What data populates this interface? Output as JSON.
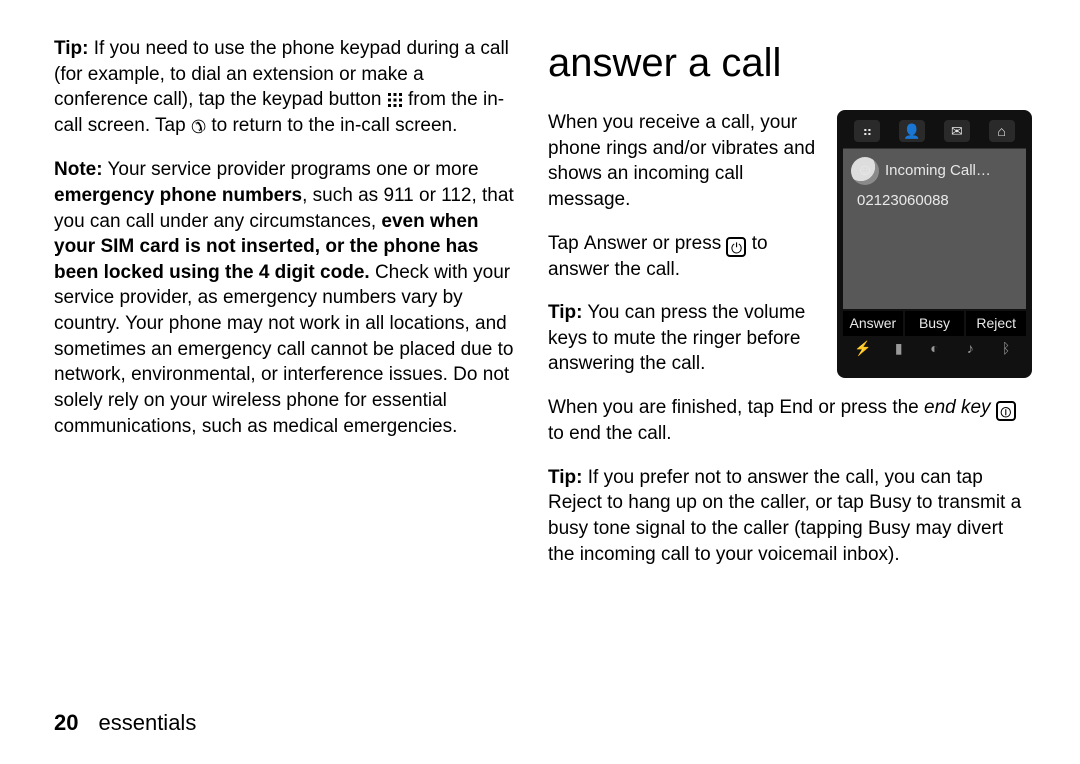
{
  "left": {
    "tip_label": "Tip:",
    "tip_text_a": " If you need to use the phone keypad during a call (for example, to dial an extension or make a conference call), tap the keypad button ",
    "tip_text_b": " from the in-call screen. Tap ",
    "tip_text_c": " to return to the in-call screen.",
    "note_label": "Note:",
    "note_a": " Your service provider programs one or more ",
    "note_b_bold": "emergency phone numbers",
    "note_c": ", such as 911 or 112, that you can call under any circumstances, ",
    "note_d_bold": "even when your SIM card is not inserted, or the phone has been locked using the 4 digit code.",
    "note_e": " Check with your service provider, as emergency numbers vary by country. Your phone may not work in all locations, and sometimes an emergency call cannot be placed due to network, environmental, or interference issues. Do not solely rely on your wireless phone for essential communications, such as medical emergencies."
  },
  "right": {
    "title": "answer a call",
    "intro": "When you receive a call, your phone rings and/or vibrates and shows an incoming call message.",
    "tap_a": "Tap ",
    "answer_label": "Answer",
    "tap_b": " or press ",
    "tap_c": " to answer the call.",
    "tip2_label": "Tip:",
    "tip2_text": " You can press the volume keys to mute the ringer before answering the call.",
    "end_a": "When you are finished, tap ",
    "end_label": "End",
    "end_b": " or press the ",
    "end_key_italic": "end key",
    "end_c": " to end the call.",
    "tip3_label": "Tip:",
    "tip3_a": " If you prefer not to answer the call, you can tap ",
    "reject_label": "Reject",
    "tip3_b": " to hang up on the caller, or tap ",
    "busy_label": "Busy",
    "tip3_c": " to transmit a busy tone signal to the caller (tapping ",
    "tip3_d": " may divert the incoming call to your voicemail inbox)."
  },
  "phone": {
    "incoming": "Incoming Call…",
    "number": "02123060088",
    "sk_answer": "Answer",
    "sk_busy": "Busy",
    "sk_reject": "Reject"
  },
  "footer": {
    "page": "20",
    "section": "essentials"
  }
}
